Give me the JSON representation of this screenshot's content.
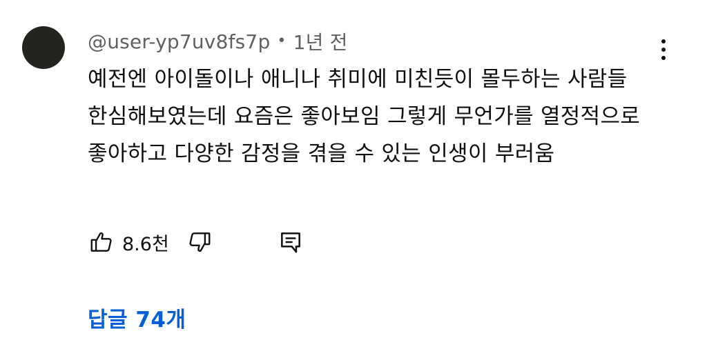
{
  "comment": {
    "author": "@user-yp7uv8fs7p",
    "separator": "•",
    "time_ago": "1년 전",
    "text": "예전엔 아이돌이나 애니나 취미에 미친듯이 몰두하는 사람들 한심해보였는데 요즘은 좋아보임 그렇게 무언가를 열정적으로 좋아하고 다양한 감정을 겪을 수 있는 인생이 부러움",
    "likes": "8.6천",
    "replies_label": "답글 74개"
  },
  "colors": {
    "avatar": "#23231f",
    "meta_text": "#606060",
    "link_blue": "#065fd4"
  },
  "icons": {
    "menu": "more-vert-icon",
    "like": "thumbs-up-icon",
    "dislike": "thumbs-down-icon",
    "reply": "comment-icon"
  }
}
